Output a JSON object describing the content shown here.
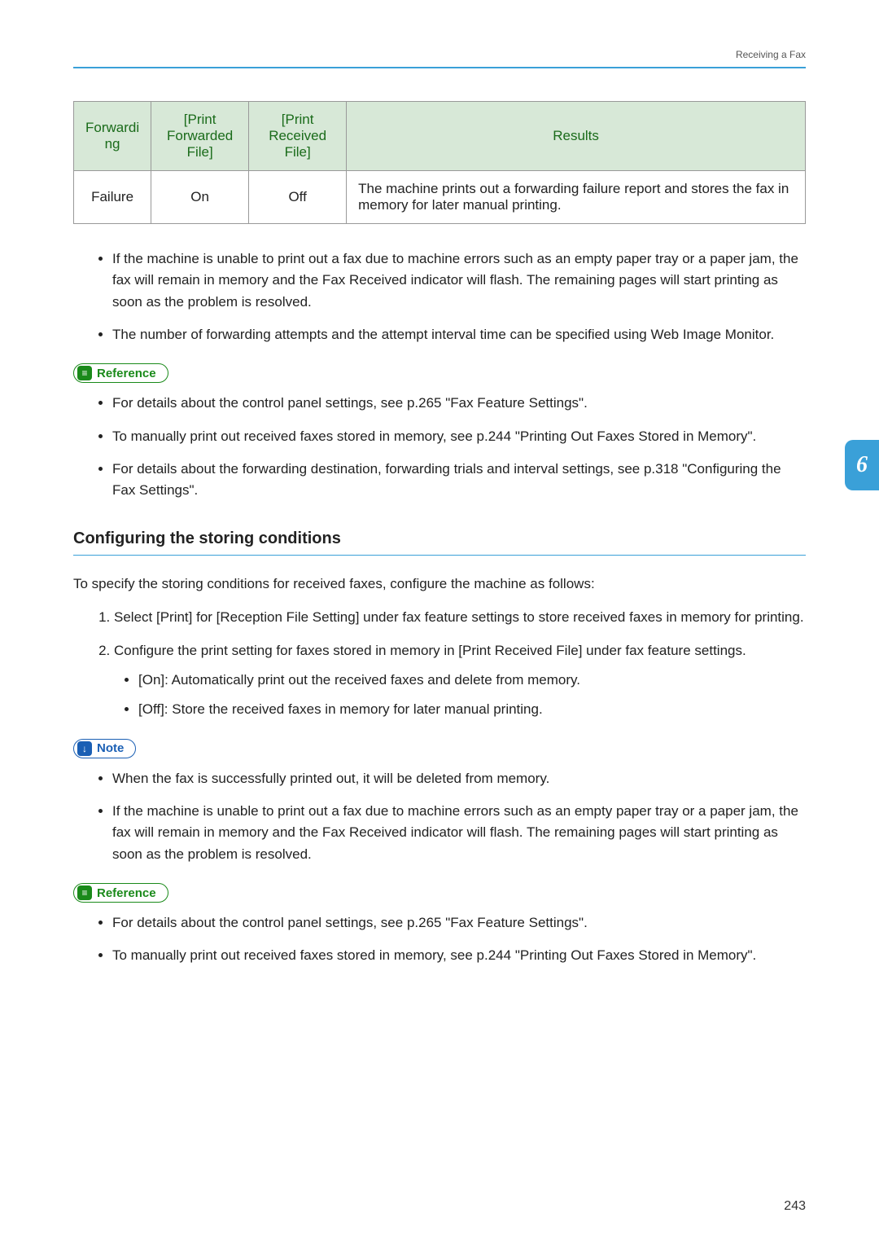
{
  "header": {
    "breadcrumb": "Receiving a Fax"
  },
  "table": {
    "headers": {
      "col1": "Forwardi\nng",
      "col2": "[Print Forwarded File]",
      "col3": "[Print Received File]",
      "col4": "Results"
    },
    "row": {
      "c1": "Failure",
      "c2": "On",
      "c3": "Off",
      "c4": "The machine prints out a forwarding failure report and stores the fax in memory for later manual printing."
    }
  },
  "bullets_top": [
    "If the machine is unable to print out a fax due to machine errors such as an empty paper tray or a paper jam, the fax will remain in memory and the Fax Received indicator will flash. The remaining pages will start printing as soon as the problem is resolved.",
    "The number of forwarding attempts and the attempt interval time can be specified using Web Image Monitor."
  ],
  "badges": {
    "reference": "Reference",
    "note": "Note"
  },
  "reference1": [
    "For details about the control panel settings, see p.265 \"Fax Feature Settings\".",
    "To manually print out received faxes stored in memory, see p.244 \"Printing Out Faxes Stored in Memory\".",
    "For details about the forwarding destination, forwarding trials and interval settings, see p.318 \"Configuring the Fax Settings\"."
  ],
  "section": {
    "heading": "Configuring the storing conditions",
    "intro": "To specify the storing conditions for received faxes, configure the machine as follows:",
    "steps": [
      {
        "text": "Select [Print] for [Reception File Setting] under fax feature settings to store received faxes in memory for printing.",
        "sub": []
      },
      {
        "text": "Configure the print setting for faxes stored in memory in [Print Received File] under fax feature settings.",
        "sub": [
          "[On]: Automatically print out the received faxes and delete from memory.",
          "[Off]: Store the received faxes in memory for later manual printing."
        ]
      }
    ]
  },
  "note_bullets": [
    "When the fax is successfully printed out, it will be deleted from memory.",
    "If the machine is unable to print out a fax due to machine errors such as an empty paper tray or a paper jam, the fax will remain in memory and the Fax Received indicator will flash. The remaining pages will start printing as soon as the problem is resolved."
  ],
  "reference2": [
    "For details about the control panel settings, see p.265 \"Fax Feature Settings\".",
    "To manually print out received faxes stored in memory, see p.244 \"Printing Out Faxes Stored in Memory\"."
  ],
  "sidetab": "6",
  "pagenum": "243"
}
